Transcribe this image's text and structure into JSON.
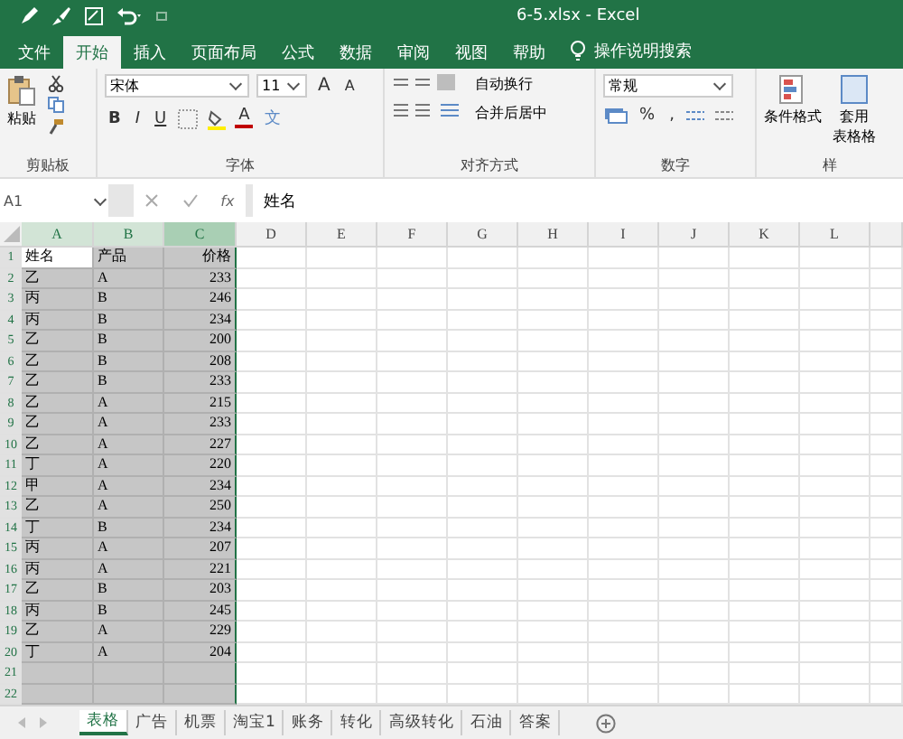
{
  "window": {
    "title": "6-5.xlsx  -  Excel"
  },
  "tabs": [
    {
      "label": "文件",
      "selected": false
    },
    {
      "label": "开始",
      "selected": true
    },
    {
      "label": "插入",
      "selected": false
    },
    {
      "label": "页面布局",
      "selected": false
    },
    {
      "label": "公式",
      "selected": false
    },
    {
      "label": "数据",
      "selected": false
    },
    {
      "label": "审阅",
      "selected": false
    },
    {
      "label": "视图",
      "selected": false
    },
    {
      "label": "帮助",
      "selected": false
    }
  ],
  "tell_me": "操作说明搜索",
  "ribbon": {
    "clipboard": {
      "paste": "粘贴",
      "label": "剪贴板"
    },
    "font": {
      "name": "宋体",
      "size": "11",
      "grow": "A",
      "shrink": "A",
      "bold": "B",
      "italic": "I",
      "underline": "U",
      "font_color_label": "A",
      "phonetic": "文",
      "label": "字体"
    },
    "alignment": {
      "wrap": "自动换行",
      "merge": "合并后居中",
      "label": "对齐方式"
    },
    "number": {
      "format": "常规",
      "percent": "%",
      "comma": ",",
      "label": "数字"
    },
    "styles": {
      "conditional": "条件格式",
      "table_format_1": "套用",
      "table_format_2": "表格格",
      "label": "样"
    }
  },
  "formula_bar": {
    "name_box": "A1",
    "fx": "fx",
    "value": "姓名"
  },
  "columns": [
    {
      "label": "A",
      "selected": true
    },
    {
      "label": "B",
      "selected": true
    },
    {
      "label": "C",
      "selected": true
    },
    {
      "label": "D",
      "selected": false
    },
    {
      "label": "E",
      "selected": false
    },
    {
      "label": "F",
      "selected": false
    },
    {
      "label": "G",
      "selected": false
    },
    {
      "label": "H",
      "selected": false
    },
    {
      "label": "I",
      "selected": false
    },
    {
      "label": "J",
      "selected": false
    },
    {
      "label": "K",
      "selected": false
    },
    {
      "label": "L",
      "selected": false
    }
  ],
  "row_numbers": [
    "1",
    "2",
    "3",
    "4",
    "5",
    "6",
    "7",
    "8",
    "9",
    "10",
    "11",
    "12",
    "13",
    "14",
    "15",
    "16",
    "17",
    "18",
    "19",
    "20",
    "21",
    "22"
  ],
  "rows": [
    [
      "姓名",
      "产品",
      "价格"
    ],
    [
      "乙",
      "A",
      "233"
    ],
    [
      "丙",
      "B",
      "246"
    ],
    [
      "丙",
      "B",
      "234"
    ],
    [
      "乙",
      "B",
      "200"
    ],
    [
      "乙",
      "B",
      "208"
    ],
    [
      "乙",
      "B",
      "233"
    ],
    [
      "乙",
      "A",
      "215"
    ],
    [
      "乙",
      "A",
      "233"
    ],
    [
      "乙",
      "A",
      "227"
    ],
    [
      "丁",
      "A",
      "220"
    ],
    [
      "甲",
      "A",
      "234"
    ],
    [
      "乙",
      "A",
      "250"
    ],
    [
      "丁",
      "B",
      "234"
    ],
    [
      "丙",
      "A",
      "207"
    ],
    [
      "丙",
      "A",
      "221"
    ],
    [
      "乙",
      "B",
      "203"
    ],
    [
      "丙",
      "B",
      "245"
    ],
    [
      "乙",
      "A",
      "229"
    ],
    [
      "丁",
      "A",
      "204"
    ]
  ],
  "sheets": [
    {
      "label": "表格",
      "selected": true
    },
    {
      "label": "广告",
      "selected": false
    },
    {
      "label": "机票",
      "selected": false
    },
    {
      "label": "淘宝1",
      "selected": false
    },
    {
      "label": "账务",
      "selected": false
    },
    {
      "label": "转化",
      "selected": false
    },
    {
      "label": "高级转化",
      "selected": false
    },
    {
      "label": "石油",
      "selected": false
    },
    {
      "label": "答案",
      "selected": false
    }
  ]
}
